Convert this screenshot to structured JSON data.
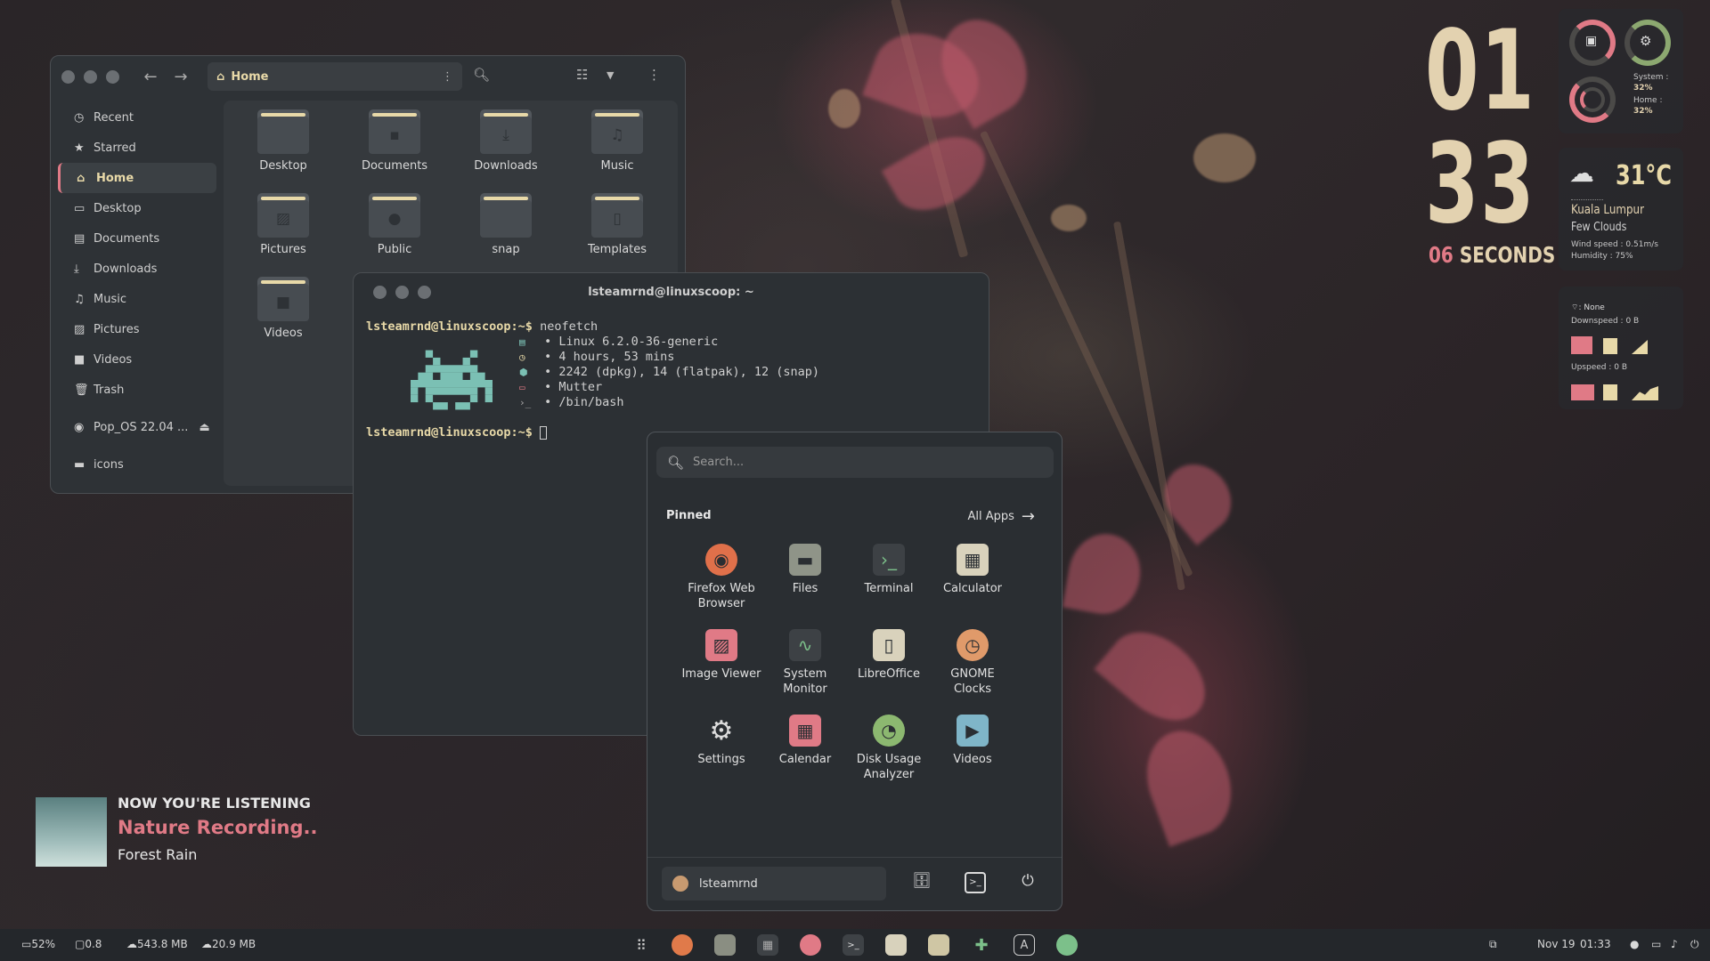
{
  "files": {
    "path": "Home",
    "sidebar": [
      {
        "label": "Recent",
        "icon": "clock-icon"
      },
      {
        "label": "Starred",
        "icon": "star-icon"
      },
      {
        "label": "Home",
        "icon": "home-icon"
      },
      {
        "label": "Desktop",
        "icon": "desktop-icon"
      },
      {
        "label": "Documents",
        "icon": "document-icon"
      },
      {
        "label": "Downloads",
        "icon": "download-icon"
      },
      {
        "label": "Music",
        "icon": "music-icon"
      },
      {
        "label": "Pictures",
        "icon": "picture-icon"
      },
      {
        "label": "Videos",
        "icon": "video-icon"
      },
      {
        "label": "Trash",
        "icon": "trash-icon"
      },
      {
        "label": "Pop_OS 22.04 ...",
        "icon": "disc-icon"
      },
      {
        "label": "icons",
        "icon": "folder-icon"
      }
    ],
    "folders": [
      {
        "label": "Desktop"
      },
      {
        "label": "Documents"
      },
      {
        "label": "Downloads"
      },
      {
        "label": "Music"
      },
      {
        "label": "Pictures"
      },
      {
        "label": "Public"
      },
      {
        "label": "snap"
      },
      {
        "label": "Templates"
      },
      {
        "label": "Videos"
      }
    ]
  },
  "terminal": {
    "title": "lsteamrnd@linuxscoop: ~",
    "prompt1": "lsteamrnd@linuxscoop:~$",
    "command": " neofetch",
    "lines": [
      " • Linux 6.2.0-36-generic",
      " • 4 hours, 53 mins",
      " • 2242 (dpkg), 14 (flatpak), 12 (snap)",
      " • Mutter",
      " • /bin/bash"
    ],
    "prompt2": "lsteamrnd@linuxscoop:~$"
  },
  "menu": {
    "search_placeholder": "Search...",
    "pinned_label": "Pinned",
    "all_apps_label": "All Apps",
    "apps": [
      {
        "label": "Firefox Web Browser",
        "icon": "firefox-icon"
      },
      {
        "label": "Files",
        "icon": "files-icon"
      },
      {
        "label": "Terminal",
        "icon": "terminal-icon"
      },
      {
        "label": "Calculator",
        "icon": "calculator-icon"
      },
      {
        "label": "Image Viewer",
        "icon": "image-viewer-icon"
      },
      {
        "label": "System Monitor",
        "icon": "system-monitor-icon"
      },
      {
        "label": "LibreOffice",
        "icon": "libreoffice-icon"
      },
      {
        "label": "GNOME Clocks",
        "icon": "clock-icon"
      },
      {
        "label": "Settings",
        "icon": "gear-icon"
      },
      {
        "label": "Calendar",
        "icon": "calendar-icon"
      },
      {
        "label": "Disk Usage Analyzer",
        "icon": "pie-chart-icon"
      },
      {
        "label": "Videos",
        "icon": "videos-icon"
      }
    ],
    "user": "lsteamrnd"
  },
  "clock": {
    "hours": "01",
    "minutes": "33",
    "seconds_num": "06",
    "seconds_label": "SECONDS"
  },
  "sysinfo": {
    "system_label": "System :",
    "system_value": "32%",
    "home_label": "Home :",
    "home_value": "32%"
  },
  "weather": {
    "temp": "31°C",
    "city": "Kuala Lumpur",
    "desc": "Few Clouds",
    "wind": "Wind speed : 0.51m/s",
    "humidity": "Humidity : 75%"
  },
  "network": {
    "ssid": ": None",
    "down": "Downspeed : 0 B",
    "up": "Upspeed : 0 B"
  },
  "now_playing": {
    "label": "NOW YOU'RE LISTENING",
    "title": "Nature Recording..",
    "artist": "Forest Rain"
  },
  "taskbar": {
    "cpu": "52%",
    "load": "0.8",
    "mem": "543.8 MB",
    "swap": "20.9 MB",
    "date": "Nov 19",
    "time": "01:33"
  },
  "colors": {
    "accent": "#e07a86",
    "cream": "#e8d9a8",
    "panel": "#2e3236"
  }
}
